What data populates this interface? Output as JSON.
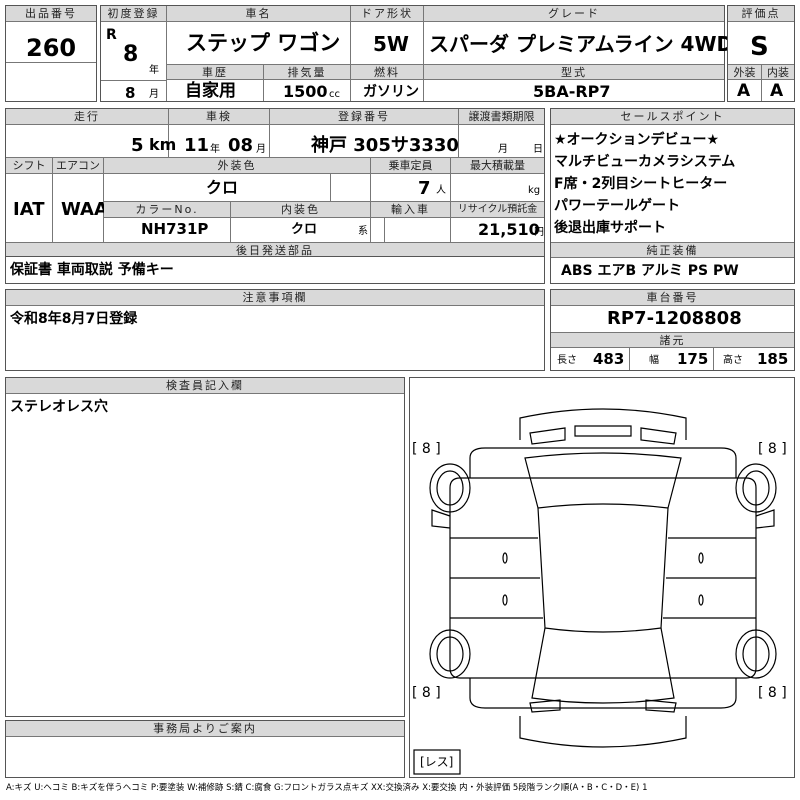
{
  "lot": {
    "label": "出品番号",
    "value": "260"
  },
  "first_reg": {
    "label": "初度登録",
    "era": "R",
    "year": "8",
    "year_unit": "年",
    "month": "8",
    "month_unit": "月"
  },
  "car_name": {
    "label": "車名",
    "value": "ステップ ワゴン"
  },
  "door": {
    "label": "ドア形状",
    "value": "5W"
  },
  "grade": {
    "label": "グレード",
    "value": "スパーダ プレミアムライン 4WD"
  },
  "score": {
    "label": "評価点",
    "value": "S"
  },
  "history": {
    "label": "車歴",
    "value": "自家用"
  },
  "displacement": {
    "label": "排気量",
    "value": "1500",
    "unit": "cc"
  },
  "fuel": {
    "label": "燃料",
    "value": "ガソリン"
  },
  "model": {
    "label": "型式",
    "value": "5BA-RP7"
  },
  "exterior_grade": {
    "label": "外装",
    "value": "A"
  },
  "interior_grade": {
    "label": "内装",
    "value": "A"
  },
  "mileage": {
    "label": "走行",
    "value": "5",
    "unit": "km"
  },
  "inspection": {
    "label": "車検",
    "year": "11",
    "year_unit": "年",
    "month": "08",
    "month_unit": "月"
  },
  "plate": {
    "label": "登録番号",
    "value": "神戸 305サ3330"
  },
  "transfer": {
    "label": "譲渡書類期限",
    "month_unit": "月",
    "day_unit": "日"
  },
  "shift": {
    "label": "シフト",
    "value": "IAT"
  },
  "aircon": {
    "label": "エアコン",
    "value": "WAA"
  },
  "ext_color": {
    "label": "外装色",
    "value": "クロ"
  },
  "capacity": {
    "label": "乗車定員",
    "value": "7",
    "unit": "人"
  },
  "max_load": {
    "label": "最大積載量",
    "unit": "kg"
  },
  "color_no": {
    "label": "カラーNo.",
    "value": "NH731P"
  },
  "int_color": {
    "label": "内装色",
    "value": "クロ",
    "unit": "系"
  },
  "import": {
    "label": "輸入車"
  },
  "recycle": {
    "label": "リサイクル預託金",
    "value": "21,510",
    "unit": "円"
  },
  "later_parts": {
    "label": "後日発送部品",
    "value": "保証書 車両取説 予備キー"
  },
  "selling_points": {
    "label": "セールスポイント",
    "items": [
      "★オークションデビュー★",
      "マルチビューカメラシステム",
      "F席・2列目シートヒーター",
      "パワーテールゲート",
      "後退出庫サポート"
    ]
  },
  "equipment": {
    "label": "純正装備",
    "value": "ABS エアB アルミ PS PW"
  },
  "notes": {
    "label": "注意事項欄",
    "value": "令和8年8月7日登録"
  },
  "chassis": {
    "label": "車台番号",
    "value": "RP7-1208808"
  },
  "specs": {
    "label": "諸元",
    "length_label": "長さ",
    "length": "483",
    "width_label": "幅",
    "width": "175",
    "height_label": "高さ",
    "height": "185"
  },
  "inspector": {
    "label": "検査員記入欄",
    "value": "ステレオレス穴"
  },
  "office": {
    "label": "事務局よりご案内"
  },
  "diagram": {
    "tire_tl": "[ 8 ]",
    "tire_tr": "[ 8 ]",
    "tire_bl": "[ 8 ]",
    "tire_br": "[ 8 ]",
    "spare": "[レス]"
  },
  "legend": "A:キズ U:ヘコミ B:キズを伴うヘコミ P:要塗装 W:補修跡 S:錆 C:腐食 G:フロントガラス点キズ XX:交換済み X:要交換 内・外装評価 5段階ランク順(A・B・C・D・E) 1"
}
